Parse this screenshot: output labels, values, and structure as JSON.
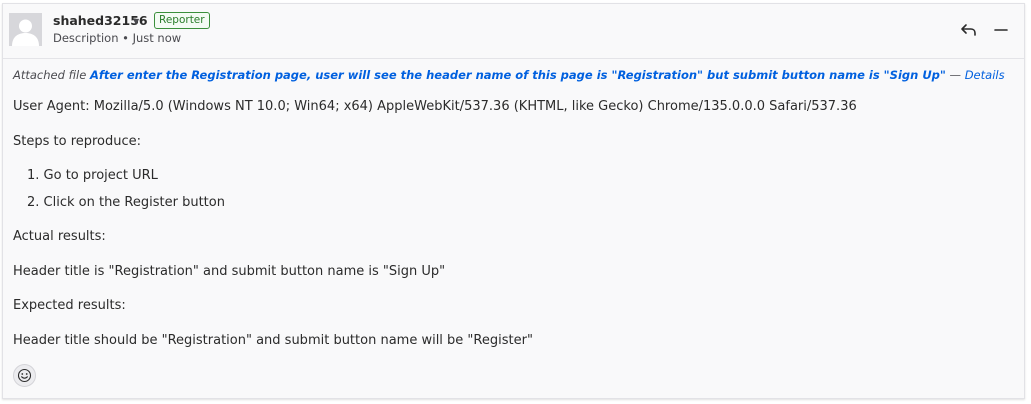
{
  "comment": {
    "author": "shahed32156",
    "role_badge": "Reporter",
    "meta": "Description • Just now",
    "attachment": {
      "prefix": "Attached file",
      "title": "After enter the Registration page, user will see the header name of this page is \"Registration\" but submit button name is \"Sign Up\"",
      "separator": "—",
      "details_label": "Details"
    },
    "user_agent": "User Agent: Mozilla/5.0 (Windows NT 10.0; Win64; x64) AppleWebKit/537.36 (KHTML, like Gecko) Chrome/135.0.0.0 Safari/537.36",
    "steps_heading": "Steps to reproduce:",
    "steps": [
      "1. Go to project URL",
      "2. Click on the Register button"
    ],
    "actual_heading": "Actual results:",
    "actual_text": "Header title is \"Registration\" and submit button name is \"Sign Up\"",
    "expected_heading": "Expected results:",
    "expected_text": "Header title should be \"Registration\" and submit button name will be \"Register\""
  },
  "icons": {
    "avatar": "default-avatar-icon",
    "caret": "chevron-down-icon",
    "reply": "reply-icon",
    "collapse": "minus-icon",
    "reaction": "smiley-icon"
  },
  "colors": {
    "link": "#0060df",
    "badge_green": "#2a7d2a",
    "background": "#f9f9fa"
  }
}
